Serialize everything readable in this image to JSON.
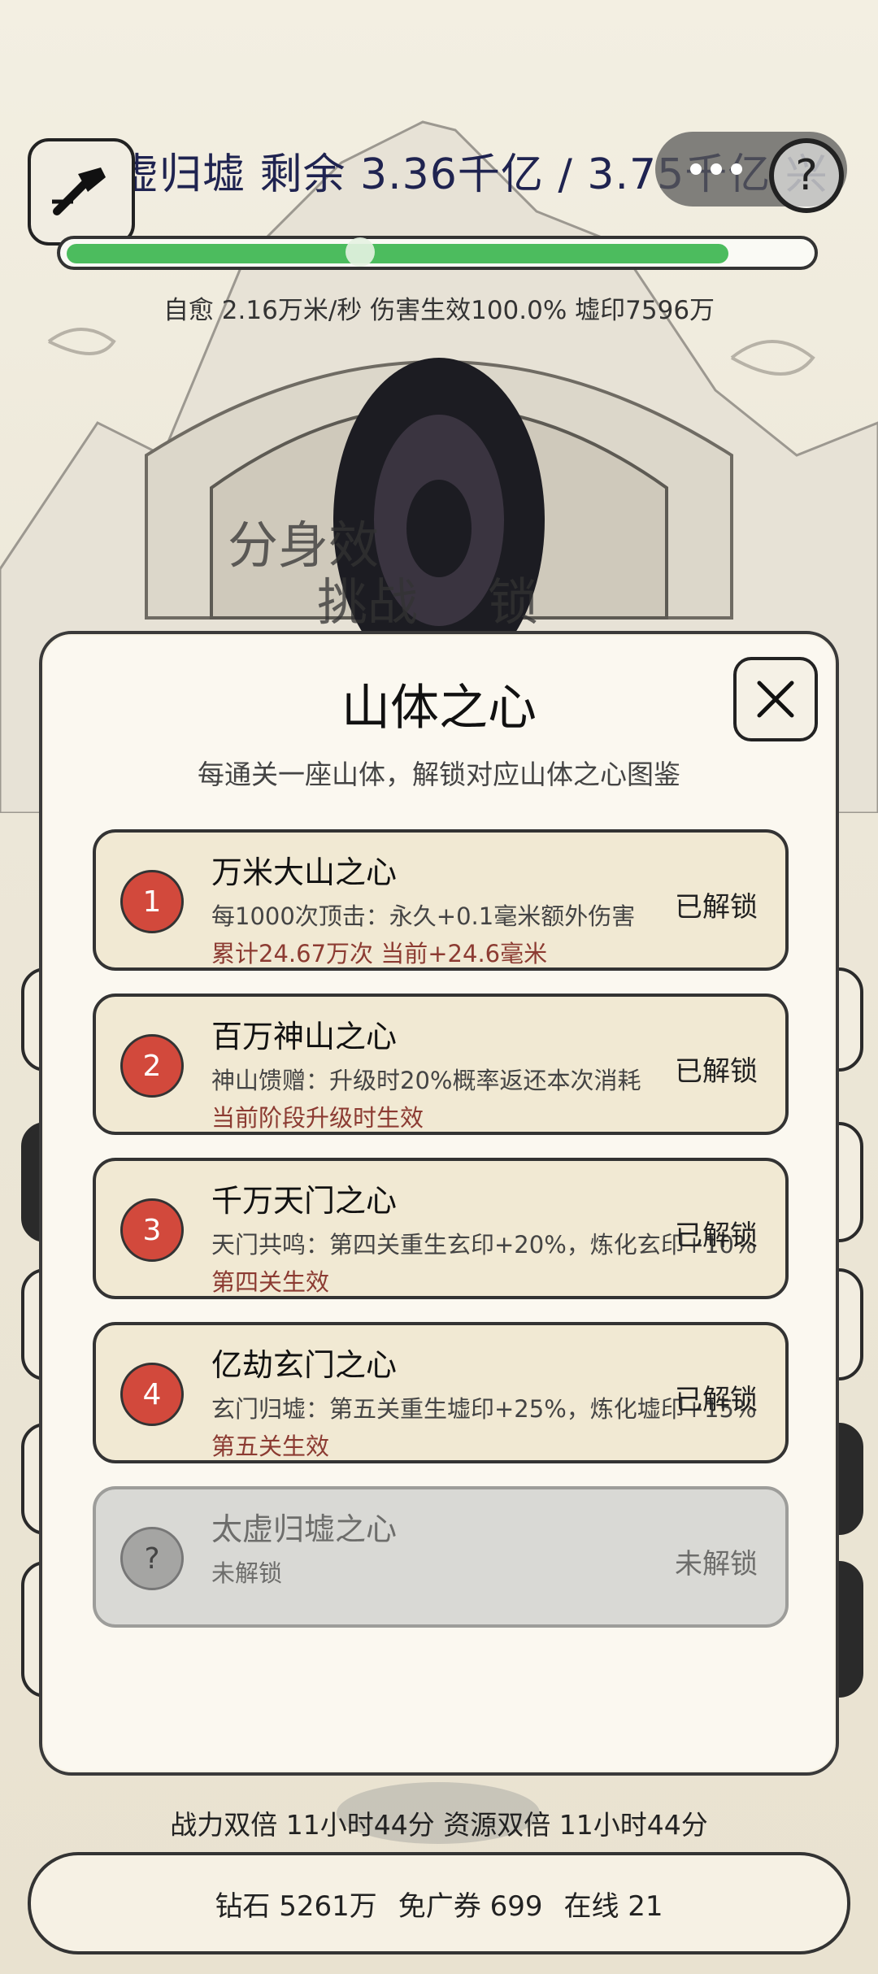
{
  "header": {
    "title": "太虚归墟  剩余 3.36千亿 / 3.75千亿 兴",
    "progress_fraction": 0.893,
    "stats": "自愈 2.16万米/秒  伤害生效100.0%  墟印7596万"
  },
  "background": {
    "overlay_text_1": "分身效",
    "overlay_text_2": "挑战",
    "overlay_text_3": "锁"
  },
  "modal": {
    "title": "山体之心",
    "subtitle": "每通关一座山体，解锁对应山体之心图鉴",
    "cards": [
      {
        "badge": "1",
        "name": "万米大山之心",
        "desc": "每1000次顶击：永久+0.1毫米额外伤害",
        "note": "累计24.67万次  当前+24.6毫米",
        "status": "已解锁"
      },
      {
        "badge": "2",
        "name": "百万神山之心",
        "desc": "神山馈赠：升级时20%概率返还本次消耗",
        "note": "当前阶段升级时生效",
        "status": "已解锁"
      },
      {
        "badge": "3",
        "name": "千万天门之心",
        "desc": "天门共鸣：第四关重生玄印+20%，炼化玄印+10%",
        "note": "第四关生效",
        "status": "已解锁"
      },
      {
        "badge": "4",
        "name": "亿劫玄门之心",
        "desc": "玄门归墟：第五关重生墟印+25%，炼化墟印+15%",
        "note": "第五关生效",
        "status": "已解锁"
      },
      {
        "badge": "?",
        "name": "太虚归墟之心",
        "desc": "未解锁",
        "note": "",
        "status": "未解锁"
      }
    ]
  },
  "buffs": "战力双倍 11小时44分  资源双倍 11小时44分",
  "footer": {
    "diamonds": "钻石 5261万",
    "ad_tickets": "免广券 699",
    "online": "在线 21"
  },
  "colors": {
    "progress": "#4cbc5e",
    "badge": "#d2493c",
    "note": "#8c3b32"
  },
  "icons": {
    "left_button": "hammer-icon",
    "help_button": "help-icon",
    "close": "close-icon"
  }
}
